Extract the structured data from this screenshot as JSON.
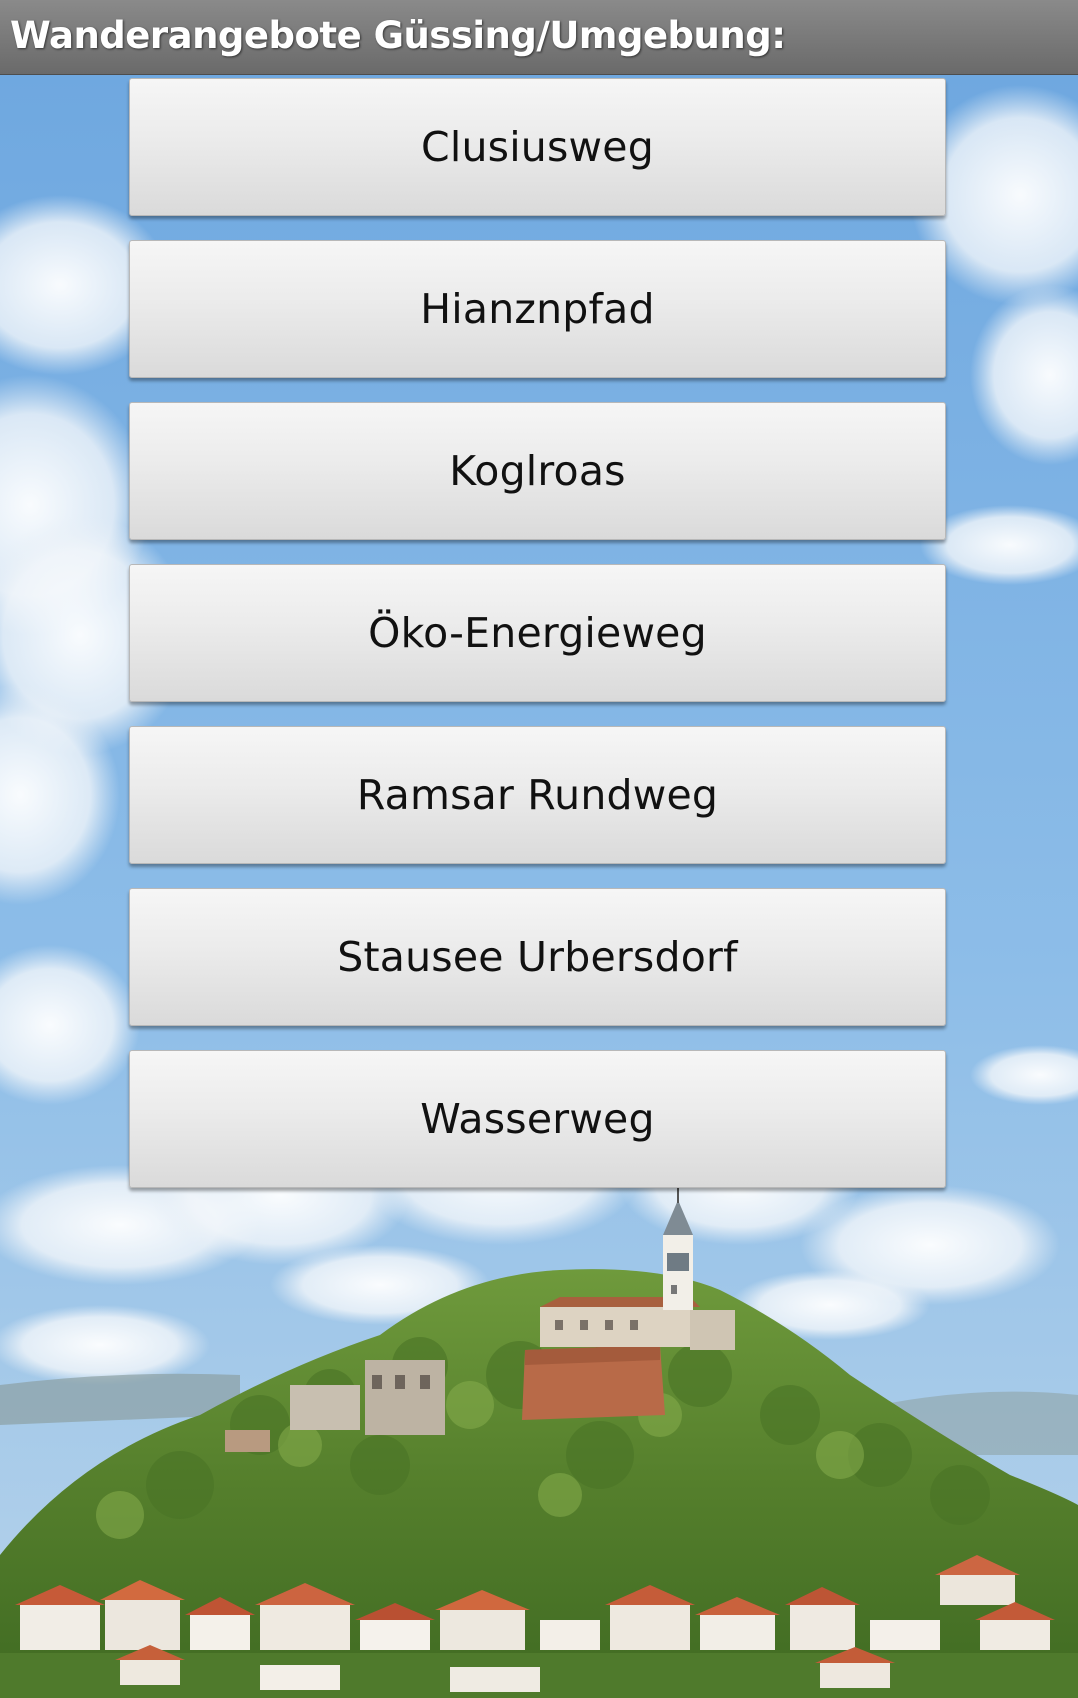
{
  "header": {
    "title": "Wanderangebote Güssing/Umgebung:"
  },
  "menu": {
    "items": [
      {
        "label": "Clusiusweg"
      },
      {
        "label": "Hianznpfad"
      },
      {
        "label": "Koglroas"
      },
      {
        "label": "Öko-Energieweg"
      },
      {
        "label": "Ramsar Rundweg"
      },
      {
        "label": "Stausee Urbersdorf"
      },
      {
        "label": "Wasserweg"
      }
    ]
  },
  "colors": {
    "title_bar": "#777777",
    "sky": "#7fb3e6",
    "button_face": "#ebebeb",
    "button_text": "#111111"
  }
}
